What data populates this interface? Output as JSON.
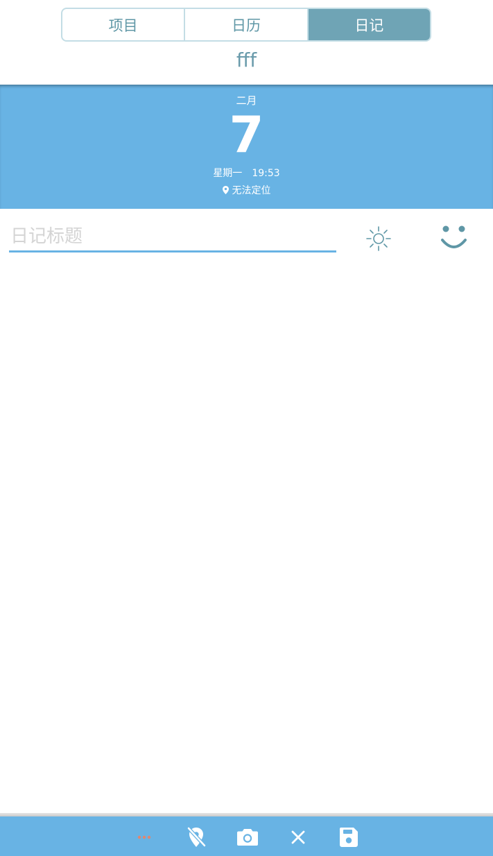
{
  "tabs": {
    "items": [
      {
        "label": "项目",
        "active": false
      },
      {
        "label": "日历",
        "active": false
      },
      {
        "label": "日记",
        "active": true
      }
    ]
  },
  "header": {
    "subtitle": "fff"
  },
  "date": {
    "month": "二月",
    "day": "7",
    "weekday": "星期一",
    "time": "19:53",
    "location": "无法定位"
  },
  "entry": {
    "title_placeholder": "日记标题",
    "title_value": ""
  },
  "toolbar": {
    "items": [
      "more-icon",
      "location-off-icon",
      "camera-icon",
      "close-icon",
      "save-icon"
    ]
  },
  "colors": {
    "accent": "#68b3e4",
    "tab_active": "#6fa4b5",
    "tab_text": "#5f97a6",
    "more_dots": "#e1876f"
  }
}
